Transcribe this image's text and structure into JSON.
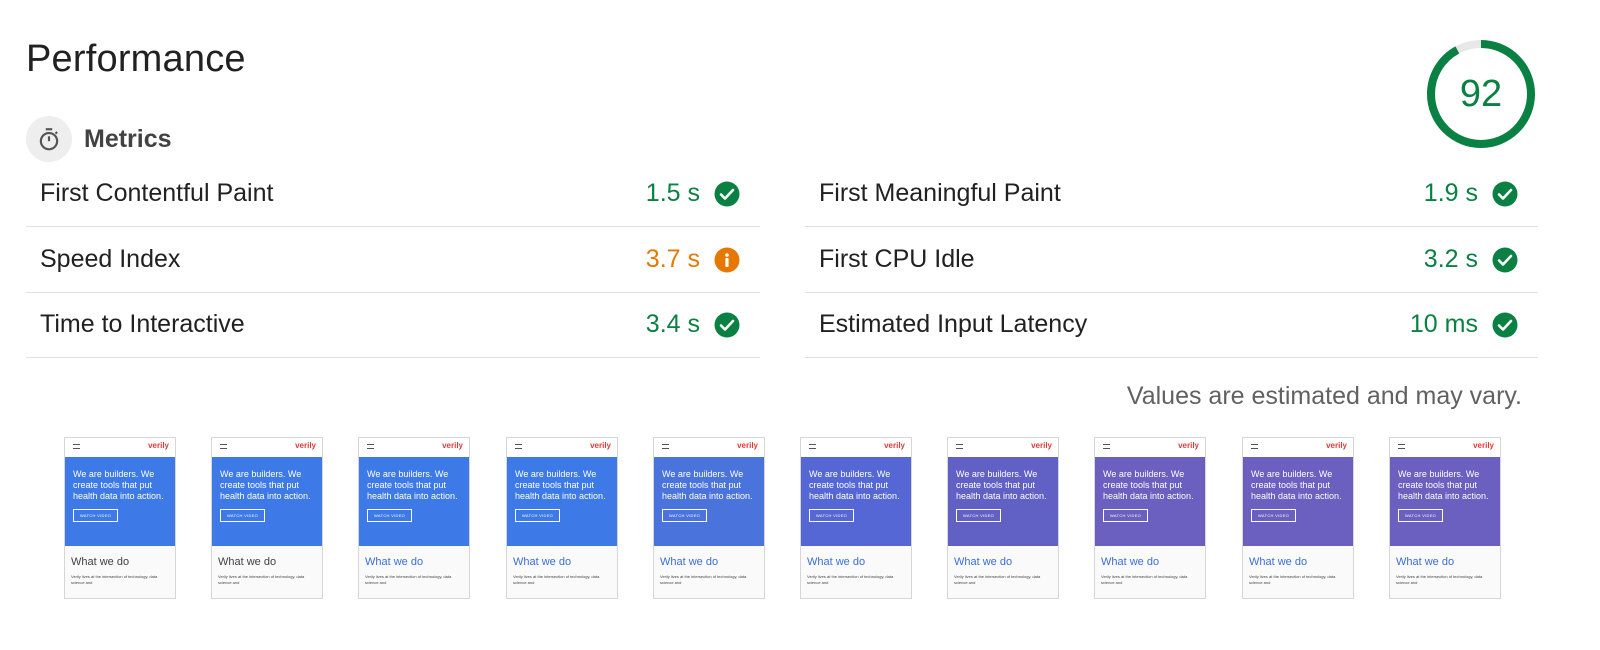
{
  "section_title": "Performance",
  "score": {
    "value": "92",
    "fraction": 0.92,
    "color": "#0b8043"
  },
  "metrics_header": {
    "label": "Metrics",
    "icon": "stopwatch-icon"
  },
  "metrics": {
    "left": [
      {
        "name": "First Contentful Paint",
        "value": "1.5 s",
        "status": "pass"
      },
      {
        "name": "Speed Index",
        "value": "3.7 s",
        "status": "average"
      },
      {
        "name": "Time to Interactive",
        "value": "3.4 s",
        "status": "pass"
      }
    ],
    "right": [
      {
        "name": "First Meaningful Paint",
        "value": "1.9 s",
        "status": "pass"
      },
      {
        "name": "First CPU Idle",
        "value": "3.2 s",
        "status": "pass"
      },
      {
        "name": "Estimated Input Latency",
        "value": "10 ms",
        "status": "pass"
      }
    ]
  },
  "status_colors": {
    "pass": "#0b8043",
    "average": "#e67700"
  },
  "note": "Values are estimated and may vary.",
  "filmstrip": {
    "brand": "verily",
    "hero_text": "We are builders. We create tools that put health data into action.",
    "button_text": "WATCH VIDEO",
    "heading": "What we do",
    "body_text": "Verily lives at the intersection of technology, data science and",
    "frames": [
      {
        "hero_color": "#3d7ae8",
        "heading_color": "#424242"
      },
      {
        "hero_color": "#3d7ae8",
        "heading_color": "#424242"
      },
      {
        "hero_color": "#3d7ae8",
        "heading_color": "#3b6fd4"
      },
      {
        "hero_color": "#3d7ae8",
        "heading_color": "#3b6fd4"
      },
      {
        "hero_color": "#4a73dc",
        "heading_color": "#3b6fd4"
      },
      {
        "hero_color": "#5567d4",
        "heading_color": "#3b6fd4"
      },
      {
        "hero_color": "#6160c4",
        "heading_color": "#3b6fd4"
      },
      {
        "hero_color": "#6b5fbf",
        "heading_color": "#3b6fd4"
      },
      {
        "hero_color": "#6b5fbf",
        "heading_color": "#3b6fd4"
      },
      {
        "hero_color": "#6b5fbf",
        "heading_color": "#3b6fd4"
      }
    ]
  }
}
